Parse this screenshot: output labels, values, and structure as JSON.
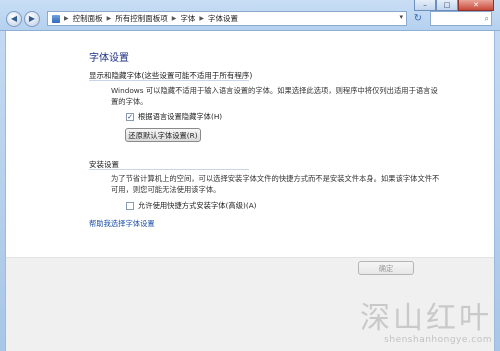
{
  "window": {
    "minimize": "–",
    "maximize": "□",
    "close": "✕",
    "nav_back": "◀",
    "nav_forward": "▶"
  },
  "address_bar": {
    "crumbs": [
      "控制面板",
      "所有控制面板项",
      "字体",
      "字体设置"
    ],
    "separator": "▶",
    "dropdown": "▾"
  },
  "refresh_glyph": "↻",
  "search": {
    "placeholder": "",
    "icon": "search-icon",
    "icon_glyph": "⌕"
  },
  "page": {
    "title": "字体设置",
    "hide_section": {
      "title": "显示和隐藏字体(这些设置可能不适用于所有程序)",
      "desc": "Windows 可以隐藏不适用于输入语言设置的字体。如果选择此选项，则程序中将仅列出适用于语言设置的字体。",
      "checkbox_label": "根据语言设置隐藏字体(H)",
      "checkbox_checked": true,
      "checkbox_glyph": "✓",
      "restore_button": "还原默认字体设置(R)"
    },
    "install_section": {
      "title": "安装设置",
      "desc": "为了节省计算机上的空间，可以选择安装字体文件的快捷方式而不是安装文件本身。如果该字体文件不可用，则您可能无法使用该字体。",
      "checkbox_label": "允许使用快捷方式安装字体(高级)(A)",
      "checkbox_checked": false
    },
    "help_link": "帮助我选择字体设置"
  },
  "footer": {
    "ok_button": "确定"
  },
  "watermark": {
    "big": "深山红叶",
    "small": "shenshanhongye.com"
  },
  "colors": {
    "title": "#1e3287",
    "link": "#1a4fa8",
    "chrome": "#b5d1ef"
  }
}
